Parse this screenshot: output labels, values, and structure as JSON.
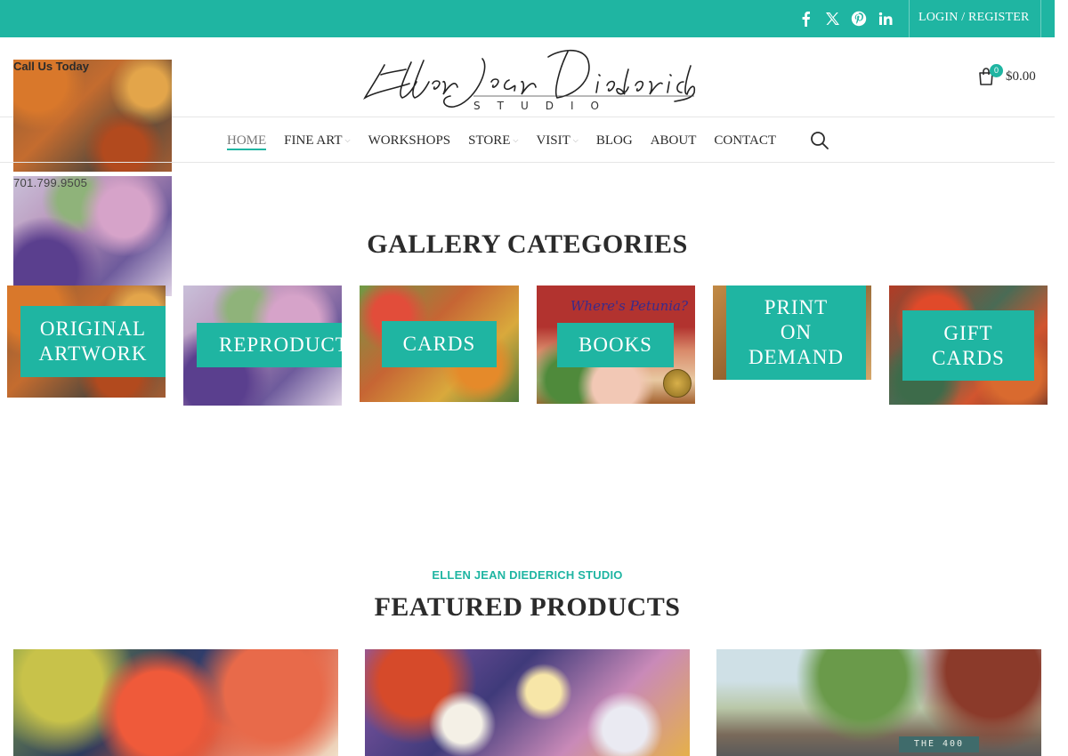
{
  "colors": {
    "accent": "#1fb5a2",
    "text": "#2b2b2b"
  },
  "topbar": {
    "social": [
      {
        "name": "facebook-icon"
      },
      {
        "name": "x-twitter-icon"
      },
      {
        "name": "pinterest-icon"
      },
      {
        "name": "linkedin-icon"
      }
    ],
    "login_label": "LOGIN / REGISTER"
  },
  "header": {
    "call_label": "Call Us Today",
    "phone": "701.799.9505",
    "logo_signature": "Ellen Jean Diederich",
    "logo_sub": "STUDIO",
    "cart_count": "0",
    "cart_total": "$0.00"
  },
  "nav": {
    "items": [
      {
        "label": "HOME",
        "active": true
      },
      {
        "label": "FINE ART",
        "dropdown": true
      },
      {
        "label": "WORKSHOPS"
      },
      {
        "label": "STORE",
        "dropdown": true
      },
      {
        "label": "VISIT",
        "dropdown": true
      },
      {
        "label": "BLOG"
      },
      {
        "label": "ABOUT"
      },
      {
        "label": "CONTACT"
      }
    ],
    "search_icon": "search-icon"
  },
  "gallery": {
    "title": "GALLERY CATEGORIES",
    "tiles": [
      {
        "label": "ORIGINAL\nARTWORK"
      },
      {
        "label": "REPRODUCTIONS"
      },
      {
        "label": "CARDS"
      },
      {
        "label": "BOOKS",
        "cover_title": "Where's Petunia?"
      },
      {
        "label": "PRINT\nON\nDEMAND"
      },
      {
        "label": "GIFT\nCARDS"
      }
    ]
  },
  "featured": {
    "kicker": "ELLEN JEAN DIEDERICH STUDIO",
    "title": "FEATURED PRODUCTS",
    "marquee_text": "THE 400"
  }
}
